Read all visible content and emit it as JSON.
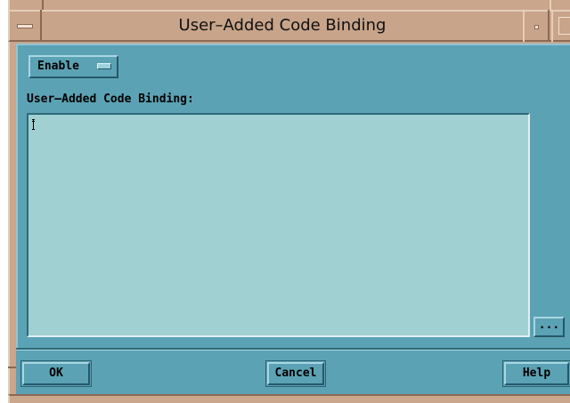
{
  "window": {
    "title": "User–Added Code Binding"
  },
  "toolbar": {
    "enable_label": "Enable"
  },
  "form": {
    "field_label": "User–Added Code Binding:",
    "field_value": "",
    "ellipsis_label": "..."
  },
  "footer": {
    "ok_label": "OK",
    "cancel_label": "Cancel",
    "help_label": "Help"
  },
  "colors": {
    "dialog_bg": "#5ba2b4",
    "text_area_bg": "#a0d0d2",
    "frame": "#c9a68c"
  },
  "icons": {
    "window_menu": "window-menu-icon",
    "minimize": "minimize-icon",
    "maximize": "maximize-icon",
    "caret": "text-cursor-icon"
  }
}
